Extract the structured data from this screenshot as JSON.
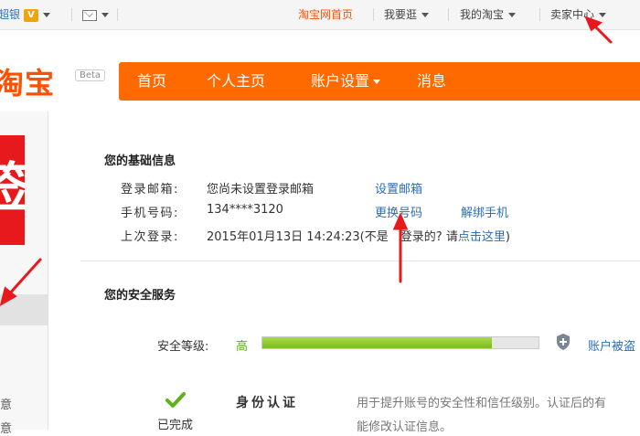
{
  "topbar": {
    "left_link": "超银",
    "home_link": "淘宝网首页",
    "wo_yao_guang": "我要逛",
    "my_taobao": "我的淘宝",
    "seller_center": "卖家中心"
  },
  "header": {
    "logo": "淘宝",
    "beta": "Beta",
    "nav": [
      "首页",
      "个人主页",
      "账户设置",
      "消息"
    ]
  },
  "sidebar": {
    "banner_char": "签",
    "text_1": "意",
    "text_2": "意"
  },
  "basic_info": {
    "title": "您的基础信息",
    "email_label": "登录邮箱:",
    "email_value": "您尚未设置登录邮箱",
    "email_link": "设置邮箱",
    "phone_label": "手机号码:",
    "phone_value": "134****3120",
    "phone_change_link": "更换号码",
    "phone_unbind_link": "解绑手机",
    "last_login_label": "上次登录:",
    "last_login_value": "2015年01月13日 14:24:23(不是",
    "last_login_hidden": "您",
    "last_login_mid": "登录的? 请",
    "last_login_link": "点击这里",
    "last_login_end": ")"
  },
  "security": {
    "title": "您的安全服务",
    "level_label": "安全等级:",
    "level_value": "高",
    "level_progress": 0.83,
    "protect_link": "账户被盗",
    "done_status": "已完成",
    "service_title": "身份认证",
    "service_desc_1": "用于提升账号的安全性和信任级别。认证后的有",
    "service_desc_2": "能修改认证信息。"
  },
  "colors": {
    "brand": "#ff6a00",
    "link": "#2a6ebb",
    "level_green": "#7bbd1e",
    "arrow": "#e8191c"
  }
}
